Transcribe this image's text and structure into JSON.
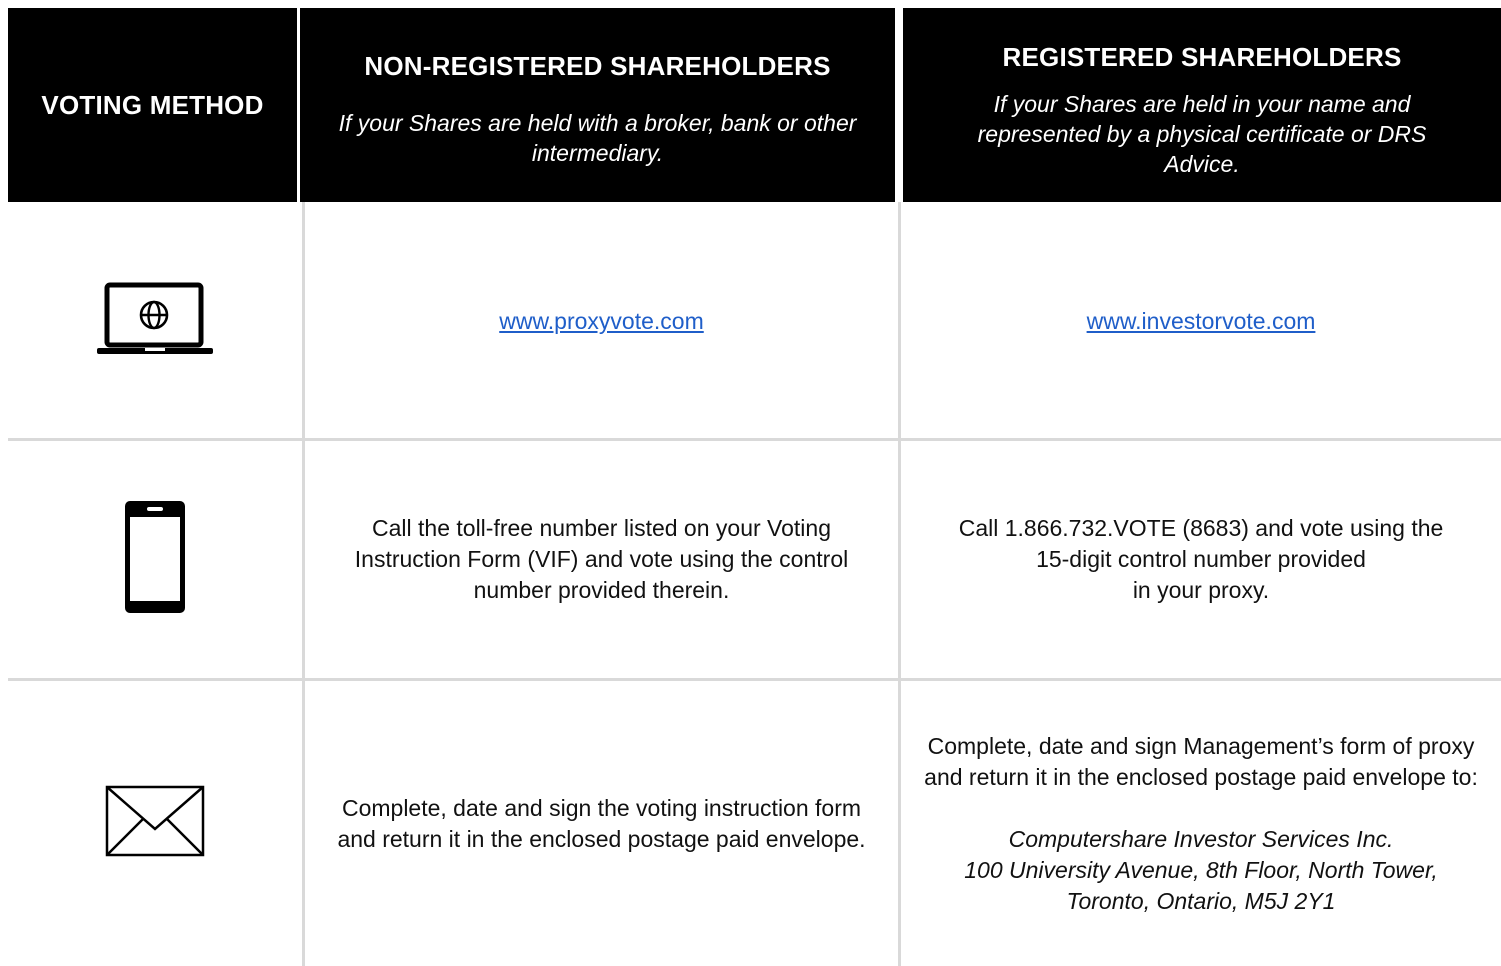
{
  "header": {
    "col1_title": "VOTING METHOD",
    "col2_title": "NON-REGISTERED SHAREHOLDERS",
    "col2_subtitle": "If your Shares are held with a broker, bank or other intermediary.",
    "col3_title": "REGISTERED SHAREHOLDERS",
    "col3_subtitle": "If your Shares are held in your name and represented by a physical certificate or DRS Advice."
  },
  "rows": [
    {
      "method_icon": "laptop-globe-icon",
      "non_registered": "www.proxyvote.com",
      "registered": "www.investorvote.com"
    },
    {
      "method_icon": "smartphone-icon",
      "non_registered": "Call the toll-free number listed on your Voting Instruction Form (VIF) and vote using the control number provided therein.",
      "registered_line1": "Call 1.866.732.VOTE (8683) and vote using the",
      "registered_line2": "15-digit control number provided",
      "registered_line3": "in your proxy."
    },
    {
      "method_icon": "envelope-icon",
      "non_registered": "Complete, date and sign the voting instruction form and return it in the enclosed postage paid envelope.",
      "registered_intro": "Complete, date and sign Management’s form of proxy and return it in the enclosed postage paid envelope to:",
      "address_line1": "Computershare Investor Services Inc.",
      "address_line2": "100 University Avenue, 8th Floor, North Tower,",
      "address_line3": "Toronto, Ontario, M5J 2Y1"
    }
  ],
  "colors": {
    "header_bg": "#000000",
    "header_text": "#ffffff",
    "link": "#1f5ec9",
    "grid": "#d9d9d9"
  }
}
